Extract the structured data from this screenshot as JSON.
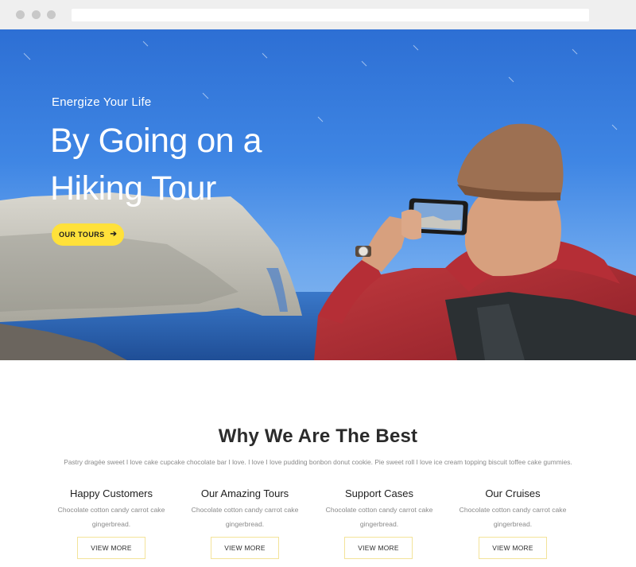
{
  "hero": {
    "eyebrow": "Energize Your Life",
    "headline": "By Going on a Hiking Tour",
    "cta_label": "OUR TOURS",
    "cta_icon": "arrow-right-icon"
  },
  "why": {
    "title": "Why We Are The Best",
    "subtitle": "Pastry dragée sweet I love cake cupcake chocolate bar I love. I love I love pudding bonbon donut cookie. Pie sweet roll I love ice cream topping biscuit toffee cake gummies."
  },
  "features": [
    {
      "title": "Happy Customers",
      "desc": "Chocolate cotton candy carrot cake gingerbread.",
      "button": "VIEW MORE"
    },
    {
      "title": "Our Amazing Tours",
      "desc": "Chocolate cotton candy carrot cake gingerbread.",
      "button": "VIEW MORE"
    },
    {
      "title": "Support Cases",
      "desc": "Chocolate cotton candy carrot cake gingerbread.",
      "button": "VIEW MORE"
    },
    {
      "title": "Our Cruises",
      "desc": "Chocolate cotton candy carrot cake gingerbread.",
      "button": "VIEW MORE"
    }
  ],
  "colors": {
    "accent": "#ffe13a",
    "button_border": "#f3e39a",
    "sky": "#3f86e4",
    "chrome": "#efefef"
  }
}
